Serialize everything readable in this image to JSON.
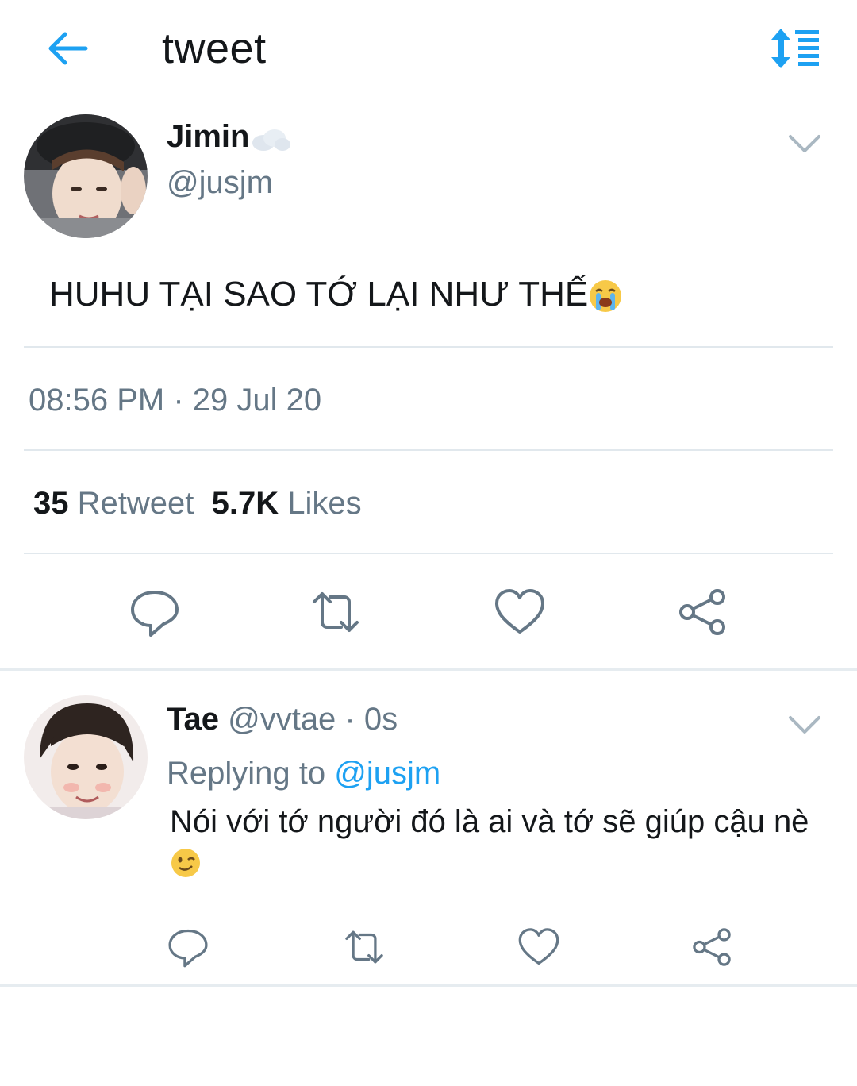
{
  "header": {
    "title": "tweet",
    "back_icon": "arrow-left-icon",
    "sort_icon": "sort-icon",
    "accent_color": "#1da1f2"
  },
  "tweet": {
    "author_name": "Jimin",
    "author_handle": "@jusjm",
    "text": "HUHU TẠI SAO TỚ LẠI NHƯ THẾ",
    "text_emoji": "loudly-crying-face",
    "timestamp": "08:56 PM · 29 Jul 20",
    "retweet_count": "35",
    "retweet_label": "Retweet",
    "like_count": "5.7K",
    "like_label": "Likes",
    "actions": [
      "reply-icon",
      "retweet-icon",
      "like-icon",
      "share-icon"
    ]
  },
  "reply": {
    "author_name": "Tae",
    "meta": "@vvtae · 0s",
    "replying_label": "Replying to",
    "replying_to": "@jusjm",
    "text": "Nói với tớ người đó là ai và tớ sẽ giúp cậu nè",
    "text_emoji": "winking-face",
    "actions": [
      "reply-icon",
      "retweet-icon",
      "like-icon",
      "share-icon"
    ]
  }
}
